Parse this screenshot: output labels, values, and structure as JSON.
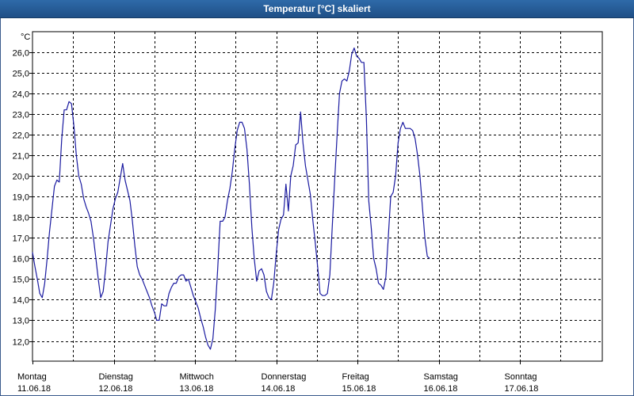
{
  "window": {
    "title": "Temperatur [°C] skaliert"
  },
  "chart_data": {
    "type": "line",
    "title": "Temperatur [°C] skaliert",
    "ylabel": "°C",
    "xlabel": "",
    "ylim": [
      11.0,
      26.5
    ],
    "xlim": [
      0,
      7.0
    ],
    "grid": true,
    "line_color": "#1a1aa0",
    "y_ticks": [
      "12,0",
      "13,0",
      "14,0",
      "15,0",
      "16,0",
      "17,0",
      "18,0",
      "19,0",
      "20,0",
      "21,0",
      "22,0",
      "23,0",
      "24,0",
      "25,0",
      "26,0"
    ],
    "x_ticks": [
      {
        "day": "Montag",
        "date": "11.06.18"
      },
      {
        "day": "Dienstag",
        "date": "12.06.18"
      },
      {
        "day": "Mittwoch",
        "date": "13.06.18"
      },
      {
        "day": "Donnerstag",
        "date": "14.06.18"
      },
      {
        "day": "Freitag",
        "date": "15.06.18"
      },
      {
        "day": "Samstag",
        "date": "16.06.18"
      },
      {
        "day": "Sonntag",
        "date": "17.06.18"
      }
    ],
    "series": [
      {
        "values": [
          [
            0.0,
            16.3
          ],
          [
            0.03,
            15.6
          ],
          [
            0.06,
            15.0
          ],
          [
            0.09,
            14.3
          ],
          [
            0.12,
            14.1
          ],
          [
            0.15,
            14.8
          ],
          [
            0.18,
            16.0
          ],
          [
            0.21,
            17.3
          ],
          [
            0.24,
            18.4
          ],
          [
            0.27,
            19.5
          ],
          [
            0.3,
            19.8
          ],
          [
            0.33,
            19.7
          ],
          [
            0.36,
            21.8
          ],
          [
            0.39,
            23.2
          ],
          [
            0.42,
            23.2
          ],
          [
            0.45,
            23.6
          ],
          [
            0.48,
            23.5
          ],
          [
            0.51,
            22.4
          ],
          [
            0.54,
            21.0
          ],
          [
            0.57,
            20.0
          ],
          [
            0.6,
            19.6
          ],
          [
            0.63,
            18.9
          ],
          [
            0.66,
            18.5
          ],
          [
            0.69,
            18.2
          ],
          [
            0.72,
            17.8
          ],
          [
            0.75,
            17.0
          ],
          [
            0.78,
            16.0
          ],
          [
            0.81,
            15.0
          ],
          [
            0.84,
            14.1
          ],
          [
            0.87,
            14.4
          ],
          [
            0.9,
            15.5
          ],
          [
            0.93,
            16.8
          ],
          [
            0.96,
            17.6
          ],
          [
            0.99,
            18.4
          ],
          [
            1.02,
            18.9
          ],
          [
            1.05,
            19.2
          ],
          [
            1.08,
            19.9
          ],
          [
            1.11,
            20.6
          ],
          [
            1.14,
            19.8
          ],
          [
            1.17,
            19.3
          ],
          [
            1.2,
            18.8
          ],
          [
            1.23,
            17.8
          ],
          [
            1.26,
            16.6
          ],
          [
            1.29,
            15.6
          ],
          [
            1.32,
            15.2
          ],
          [
            1.35,
            15.0
          ],
          [
            1.38,
            14.7
          ],
          [
            1.41,
            14.4
          ],
          [
            1.44,
            14.1
          ],
          [
            1.47,
            13.7
          ],
          [
            1.5,
            13.4
          ],
          [
            1.53,
            13.0
          ],
          [
            1.56,
            13.0
          ],
          [
            1.59,
            13.8
          ],
          [
            1.62,
            13.7
          ],
          [
            1.65,
            13.7
          ],
          [
            1.68,
            14.3
          ],
          [
            1.71,
            14.6
          ],
          [
            1.74,
            14.8
          ],
          [
            1.77,
            14.8
          ],
          [
            1.8,
            15.1
          ],
          [
            1.83,
            15.2
          ],
          [
            1.86,
            15.2
          ],
          [
            1.89,
            14.9
          ],
          [
            1.92,
            15.0
          ],
          [
            1.95,
            14.6
          ],
          [
            1.98,
            14.2
          ],
          [
            2.01,
            13.9
          ],
          [
            2.04,
            13.6
          ],
          [
            2.07,
            13.1
          ],
          [
            2.1,
            12.7
          ],
          [
            2.13,
            12.2
          ],
          [
            2.16,
            11.8
          ],
          [
            2.19,
            11.6
          ],
          [
            2.22,
            12.1
          ],
          [
            2.25,
            13.5
          ],
          [
            2.28,
            15.5
          ],
          [
            2.31,
            17.8
          ],
          [
            2.34,
            17.8
          ],
          [
            2.37,
            18.0
          ],
          [
            2.4,
            18.8
          ],
          [
            2.43,
            19.4
          ],
          [
            2.46,
            20.2
          ],
          [
            2.49,
            21.3
          ],
          [
            2.52,
            22.2
          ],
          [
            2.55,
            22.6
          ],
          [
            2.58,
            22.6
          ],
          [
            2.61,
            22.3
          ],
          [
            2.64,
            21.3
          ],
          [
            2.67,
            19.6
          ],
          [
            2.7,
            17.5
          ],
          [
            2.73,
            16.0
          ],
          [
            2.76,
            14.9
          ],
          [
            2.79,
            15.4
          ],
          [
            2.82,
            15.5
          ],
          [
            2.85,
            15.2
          ],
          [
            2.88,
            14.4
          ],
          [
            2.91,
            14.1
          ],
          [
            2.94,
            14.0
          ],
          [
            2.97,
            14.8
          ],
          [
            3.0,
            16.2
          ],
          [
            3.03,
            17.4
          ],
          [
            3.06,
            17.9
          ],
          [
            3.09,
            18.1
          ],
          [
            3.12,
            19.6
          ],
          [
            3.15,
            18.3
          ],
          [
            3.18,
            20.0
          ],
          [
            3.21,
            20.5
          ],
          [
            3.24,
            21.5
          ],
          [
            3.27,
            21.6
          ],
          [
            3.3,
            23.1
          ],
          [
            3.33,
            21.6
          ],
          [
            3.36,
            20.5
          ],
          [
            3.39,
            19.8
          ],
          [
            3.42,
            19.1
          ],
          [
            3.45,
            17.9
          ],
          [
            3.48,
            16.8
          ],
          [
            3.51,
            15.6
          ],
          [
            3.54,
            14.3
          ],
          [
            3.57,
            14.2
          ],
          [
            3.6,
            14.2
          ],
          [
            3.63,
            14.3
          ],
          [
            3.66,
            15.2
          ],
          [
            3.69,
            17.5
          ],
          [
            3.72,
            19.8
          ],
          [
            3.75,
            22.0
          ],
          [
            3.78,
            24.0
          ],
          [
            3.81,
            24.6
          ],
          [
            3.84,
            24.7
          ],
          [
            3.87,
            24.6
          ],
          [
            3.9,
            25.1
          ],
          [
            3.93,
            25.9
          ],
          [
            3.96,
            26.2
          ],
          [
            3.99,
            25.8
          ],
          [
            4.02,
            25.7
          ],
          [
            4.05,
            25.5
          ],
          [
            4.08,
            25.5
          ],
          [
            4.11,
            22.8
          ],
          [
            4.14,
            18.8
          ],
          [
            4.17,
            17.5
          ],
          [
            4.2,
            16.0
          ],
          [
            4.23,
            15.5
          ],
          [
            4.26,
            14.8
          ],
          [
            4.29,
            14.7
          ],
          [
            4.32,
            14.5
          ],
          [
            4.35,
            15.1
          ],
          [
            4.38,
            17.0
          ],
          [
            4.41,
            19.0
          ],
          [
            4.44,
            19.2
          ],
          [
            4.47,
            20.0
          ],
          [
            4.5,
            21.6
          ],
          [
            4.53,
            22.3
          ],
          [
            4.56,
            22.6
          ],
          [
            4.59,
            22.3
          ],
          [
            4.62,
            22.3
          ],
          [
            4.65,
            22.3
          ],
          [
            4.68,
            22.2
          ],
          [
            4.71,
            21.8
          ],
          [
            4.74,
            21.0
          ],
          [
            4.77,
            20.0
          ],
          [
            4.8,
            18.5
          ],
          [
            4.83,
            17.0
          ],
          [
            4.86,
            16.1
          ],
          [
            4.89,
            16.0
          ]
        ]
      }
    ]
  }
}
